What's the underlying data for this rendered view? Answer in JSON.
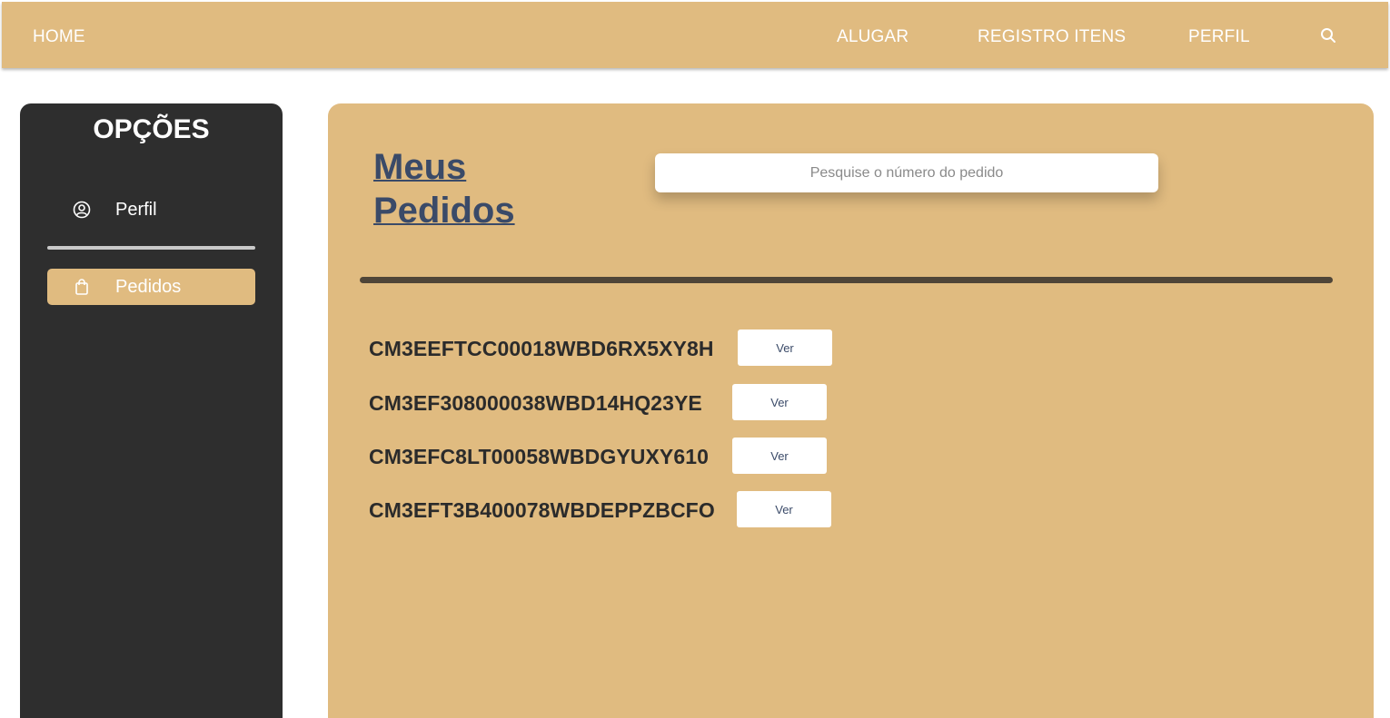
{
  "navbar": {
    "home": "HOME",
    "links": [
      "ALUGAR",
      "REGISTRO ITENS",
      "PERFIL"
    ],
    "search_icon": "search-icon"
  },
  "sidebar": {
    "title": "OPÇÕES",
    "items": [
      {
        "label": "Perfil",
        "icon": "user-circle-icon",
        "active": false
      },
      {
        "label": "Pedidos",
        "icon": "shopping-bag-icon",
        "active": true
      }
    ]
  },
  "main": {
    "title": "Meus Pedidos",
    "search": {
      "placeholder": "Pesquise o número do pedido",
      "value": ""
    },
    "orders": [
      {
        "id": "CM3EEFTCC00018WBD6RX5XY8H",
        "button": "Ver"
      },
      {
        "id": "CM3EF308000038WBD14HQ23YE",
        "button": "Ver"
      },
      {
        "id": "CM3EFC8LT00058WBDGYUXY610",
        "button": "Ver"
      },
      {
        "id": "CM3EFT3B400078WBDEPPZBCFO",
        "button": "Ver"
      }
    ]
  },
  "colors": {
    "accent": "#e0bb80",
    "sidebar_bg": "#2e2e2e",
    "title": "#3a4a68",
    "divider": "#4f4538"
  }
}
